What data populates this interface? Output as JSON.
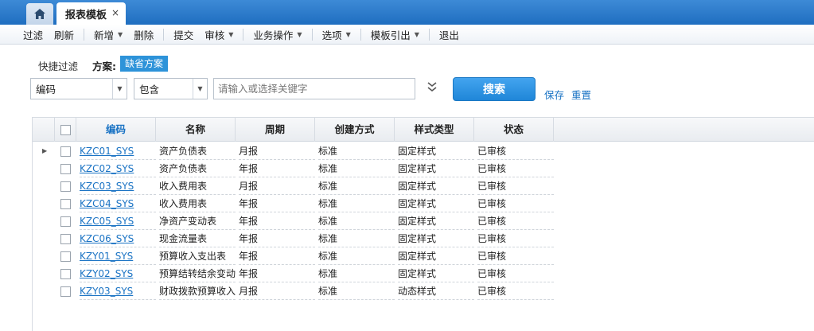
{
  "tabs": {
    "home_icon": "home-icon",
    "active_label": "报表模板",
    "close_glyph": "×"
  },
  "toolbar": [
    {
      "label": "过滤",
      "dropdown": false
    },
    {
      "label": "刷新",
      "dropdown": false
    },
    {
      "label": "新增",
      "dropdown": true
    },
    {
      "label": "删除",
      "dropdown": false
    },
    {
      "label": "提交",
      "dropdown": false
    },
    {
      "label": "审核",
      "dropdown": true
    },
    {
      "label": "业务操作",
      "dropdown": true
    },
    {
      "label": "选项",
      "dropdown": true
    },
    {
      "label": "模板引出",
      "dropdown": true
    },
    {
      "label": "退出",
      "dropdown": false
    }
  ],
  "filter": {
    "quick_filter_label": "快捷过滤",
    "scheme_label": "方案:",
    "scheme_value": "缺省方案",
    "field_value": "编码",
    "operator_value": "包含",
    "search_placeholder": "请输入或选择关键字",
    "search_button": "搜索",
    "save_link": "保存",
    "reset_link": "重置"
  },
  "grid": {
    "columns": [
      "编码",
      "名称",
      "周期",
      "创建方式",
      "样式类型",
      "状态"
    ],
    "sorted_column": "编码",
    "rows": [
      {
        "code": "KZC01_SYS",
        "name": "资产负债表",
        "period": "月报",
        "create": "标准",
        "style": "固定样式",
        "status": "已审核",
        "current": true
      },
      {
        "code": "KZC02_SYS",
        "name": "资产负债表",
        "period": "年报",
        "create": "标准",
        "style": "固定样式",
        "status": "已审核",
        "current": false
      },
      {
        "code": "KZC03_SYS",
        "name": "收入费用表",
        "period": "月报",
        "create": "标准",
        "style": "固定样式",
        "status": "已审核",
        "current": false
      },
      {
        "code": "KZC04_SYS",
        "name": "收入费用表",
        "period": "年报",
        "create": "标准",
        "style": "固定样式",
        "status": "已审核",
        "current": false
      },
      {
        "code": "KZC05_SYS",
        "name": "净资产变动表",
        "period": "年报",
        "create": "标准",
        "style": "固定样式",
        "status": "已审核",
        "current": false
      },
      {
        "code": "KZC06_SYS",
        "name": "现金流量表",
        "period": "年报",
        "create": "标准",
        "style": "固定样式",
        "status": "已审核",
        "current": false
      },
      {
        "code": "KZY01_SYS",
        "name": "预算收入支出表",
        "period": "年报",
        "create": "标准",
        "style": "固定样式",
        "status": "已审核",
        "current": false
      },
      {
        "code": "KZY02_SYS",
        "name": "预算结转结余变动",
        "period": "年报",
        "create": "标准",
        "style": "固定样式",
        "status": "已审核",
        "current": false
      },
      {
        "code": "KZY03_SYS",
        "name": "财政拨款预算收入",
        "period": "月报",
        "create": "标准",
        "style": "动态样式",
        "status": "已审核",
        "current": false
      }
    ]
  }
}
